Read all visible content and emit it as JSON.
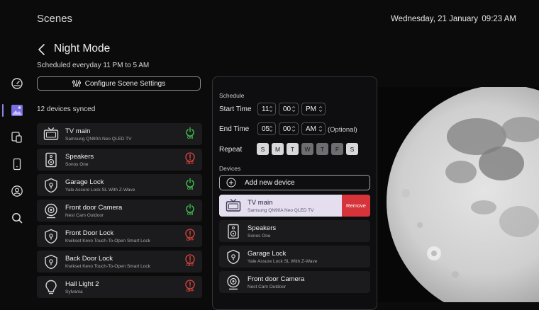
{
  "header": {
    "app_title": "Scenes",
    "date": "Wednesday, 21 January",
    "time": "09:23 AM"
  },
  "scene": {
    "title": "Night Mode",
    "subtitle": "Scheduled everyday 11 PM to 5 AM",
    "configure_label": "Configure Scene Settings",
    "synced_text": "12 devices synced"
  },
  "sidebar": {
    "items": [
      {
        "icon": "dashboard-icon"
      },
      {
        "icon": "scenes-icon",
        "active": true
      },
      {
        "icon": "devices-icon"
      },
      {
        "icon": "remote-icon"
      },
      {
        "icon": "profile-icon"
      },
      {
        "icon": "search-icon"
      }
    ],
    "accent": "#8d83e6"
  },
  "devices": [
    {
      "name": "TV main",
      "model": "Samsung QN90A Neo QLED TV",
      "icon": "tv-icon",
      "status": "ON"
    },
    {
      "name": "Speakers",
      "model": "Sonos One",
      "icon": "speaker-icon",
      "status": "OFF"
    },
    {
      "name": "Garage Lock",
      "model": "Yale Assure Lock SL With Z-Wave",
      "icon": "lock-icon",
      "status": "ON"
    },
    {
      "name": "Front door Camera",
      "model": "Nest Cam Outdoor",
      "icon": "camera-icon",
      "status": "ON"
    },
    {
      "name": "Front Door Lock",
      "model": "Kwikset Kevo Touch-To-Open Smart Lock",
      "icon": "lock-icon",
      "status": "OFF"
    },
    {
      "name": "Back Door Lock",
      "model": "Kwikset Kevo Touch-To-Open Smart Lock",
      "icon": "lock-icon",
      "status": "OFF"
    },
    {
      "name": "Hall Light 2",
      "model": "Sylvania",
      "icon": "bulb-icon",
      "status": "OFF"
    }
  ],
  "schedule": {
    "section_label": "Schedule",
    "start_label": "Start Time",
    "start": {
      "hour": "11",
      "minute": "00",
      "ampm": "PM"
    },
    "end_label": "End Time",
    "end": {
      "hour": "05",
      "minute": "00",
      "ampm": "AM"
    },
    "optional_text": "(Optional)",
    "repeat_label": "Repeat",
    "days": [
      {
        "letter": "S",
        "selected": true
      },
      {
        "letter": "M",
        "selected": true
      },
      {
        "letter": "T",
        "selected": true
      },
      {
        "letter": "W",
        "selected": false
      },
      {
        "letter": "T",
        "selected": false
      },
      {
        "letter": "F",
        "selected": false
      },
      {
        "letter": "S",
        "selected": true
      }
    ],
    "devices_label": "Devices",
    "add_device_label": "Add new device",
    "remove_label": "Remove",
    "scene_devices": [
      {
        "name": "TV main",
        "model": "Samsung QN90A Neo QLED TV",
        "icon": "tv-icon",
        "selected": true
      },
      {
        "name": "Speakers",
        "model": "Sonos One",
        "icon": "speaker-icon"
      },
      {
        "name": "Garage Lock",
        "model": "Yale Assure Lock SL With Z-Wave",
        "icon": "lock-icon"
      },
      {
        "name": "Front door Camera",
        "model": "Nest Cam Outdoor",
        "icon": "camera-icon"
      }
    ]
  },
  "colors": {
    "on": "#3cc14e",
    "off": "#e2453c",
    "remove": "#d6343a",
    "selected_row": "#e4deef"
  }
}
